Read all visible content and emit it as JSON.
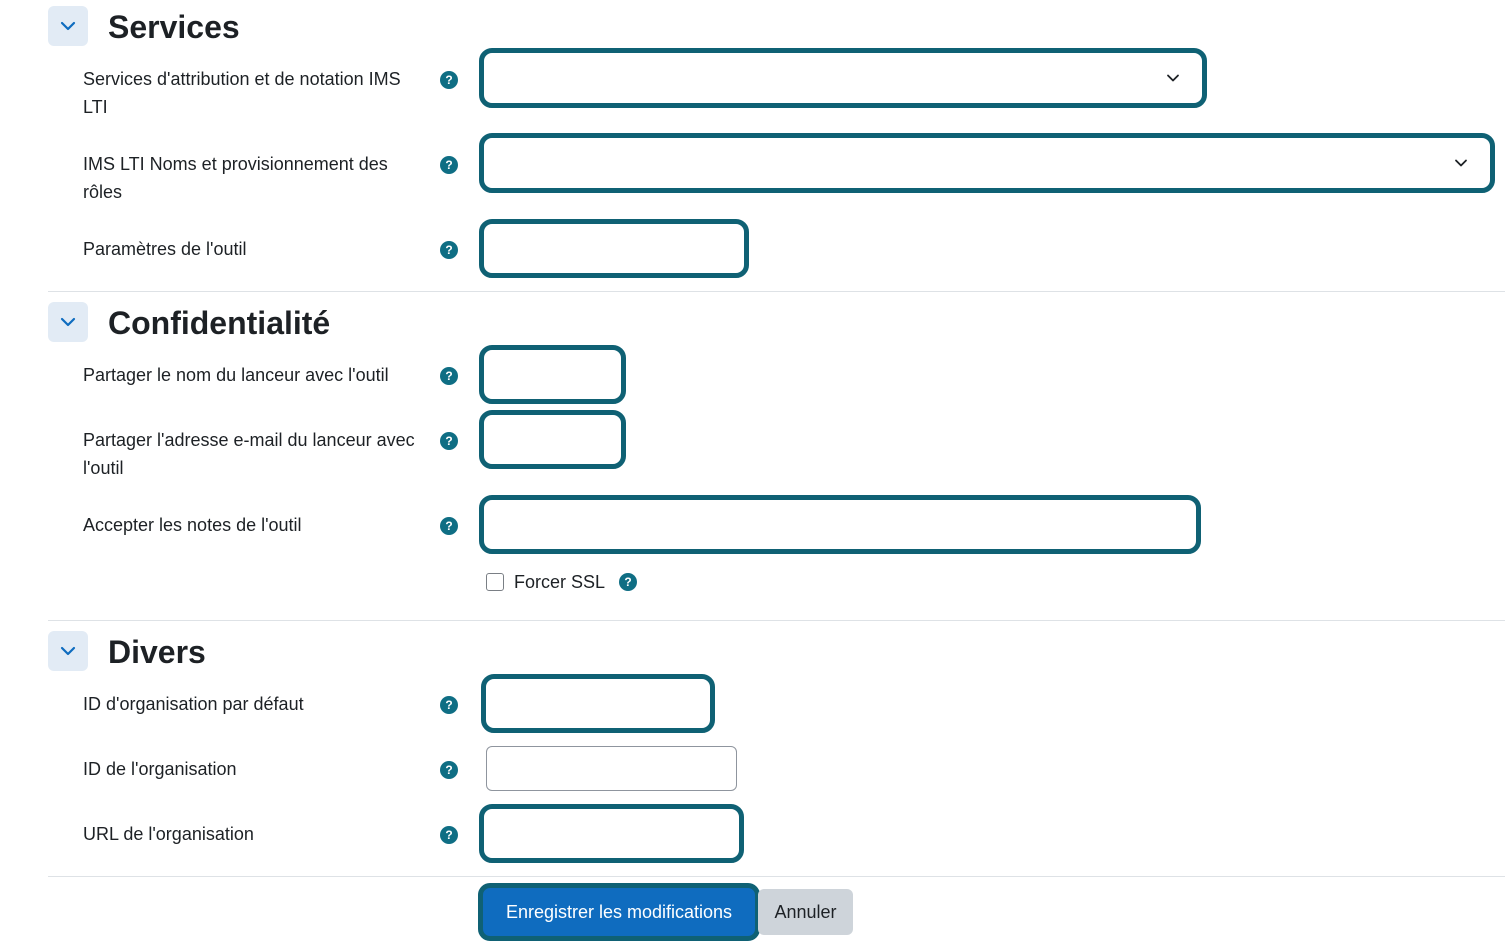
{
  "sections": {
    "services": {
      "title": "Services",
      "fields": {
        "attribution": {
          "label": "Services d'attribution et de notation IMS LTI",
          "value": ""
        },
        "roles": {
          "label": "IMS LTI Noms et provisionnement des rôles",
          "value": ""
        },
        "tool_params": {
          "label": "Paramètres de l'outil",
          "value": ""
        }
      }
    },
    "privacy": {
      "title": "Confidentialité",
      "fields": {
        "share_name": {
          "label": "Partager le nom du lanceur avec l'outil",
          "value": ""
        },
        "share_email": {
          "label": "Partager l'adresse e-mail du lanceur avec l'outil",
          "value": ""
        },
        "accept_grades": {
          "label": "Accepter les notes de l'outil",
          "value": ""
        },
        "force_ssl": {
          "label": "Forcer SSL",
          "checked": false
        }
      }
    },
    "misc": {
      "title": "Divers",
      "fields": {
        "default_org_id": {
          "label": "ID d'organisation par défaut",
          "value": ""
        },
        "org_id": {
          "label": "ID de l'organisation",
          "value": ""
        },
        "org_url": {
          "label": "URL de l'organisation",
          "value": ""
        }
      }
    }
  },
  "help_icon_glyph": "?",
  "buttons": {
    "save": "Enregistrer les modifications",
    "cancel": "Annuler"
  },
  "colors": {
    "focus_border": "#0f6174",
    "primary_button": "#0f6cbf",
    "help_icon": "#0f6e84",
    "section_toggle_bg": "#e2ebf5"
  }
}
